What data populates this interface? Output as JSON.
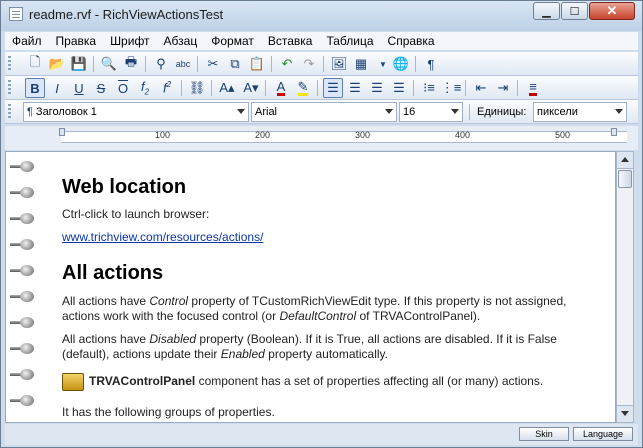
{
  "window": {
    "title": "readme.rvf - RichViewActionsTest"
  },
  "menu": [
    "Файл",
    "Правка",
    "Шрифт",
    "Абзац",
    "Формат",
    "Вставка",
    "Таблица",
    "Справка"
  ],
  "toolbar3": {
    "style": "Заголовок 1",
    "font": "Arial",
    "size": "16",
    "units_label": "Единицы:",
    "units": "пиксели"
  },
  "ruler": [
    "100",
    "200",
    "300",
    "400",
    "500"
  ],
  "doc": {
    "h1": "Web location",
    "p1": "Ctrl-click to launch browser:",
    "link": "www.trichview.com/resources/actions/",
    "h2": "All actions",
    "p2a": "All actions have ",
    "p2b": "Control",
    "p2c": " property of TCustomRichViewEdit type. If this property is not assigned,",
    "p2d": "actions work with the focused control (or ",
    "p2e": "DefaultControl",
    "p2f": " of TRVAControlPanel).",
    "p3a": "All actions have ",
    "p3b": "Disabled",
    "p3c": " property (Boolean). If it is True, all actions are disabled. If it is False",
    "p3d": "(default), actions update their ",
    "p3e": "Enabled",
    "p3f": " property automatically.",
    "p4a": "TRVAControlPanel",
    "p4b": " component has a set of properties affecting all (or many) actions.",
    "p5": "It has the following groups of properties."
  },
  "status": {
    "skin": "Skin",
    "language": "Language"
  }
}
